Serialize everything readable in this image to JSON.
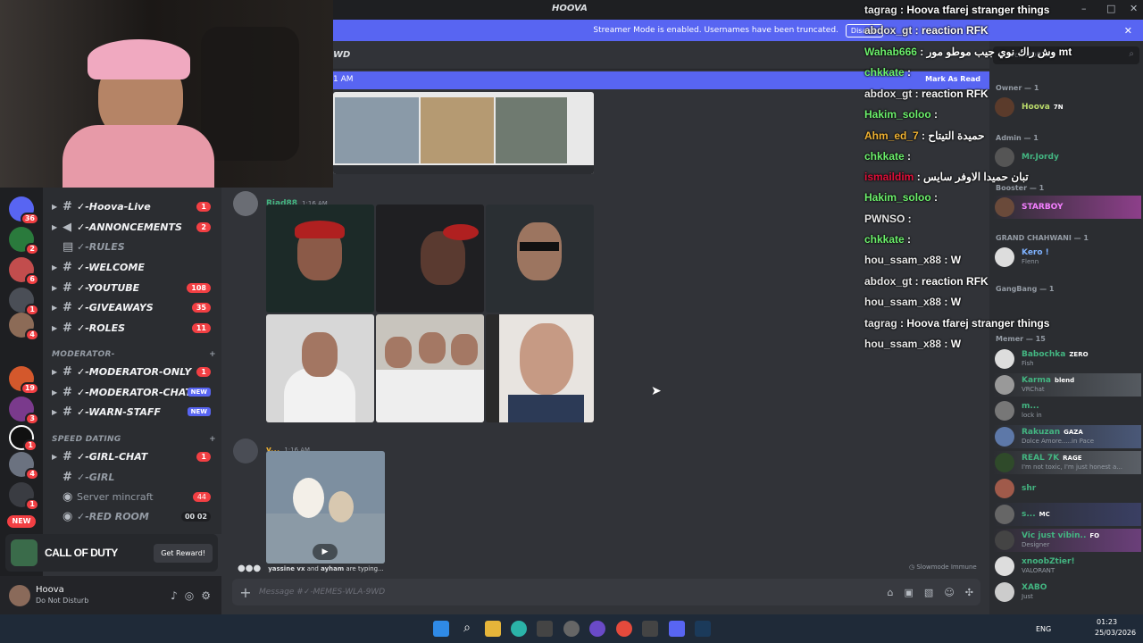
{
  "window": {
    "title": "HOOVA"
  },
  "banner": {
    "text": "Streamer Mode is enabled. Usernames have been truncated.",
    "disable": "Disable"
  },
  "channel_header": {
    "name_fragment": "WD"
  },
  "new_messages": {
    "time_fragment": "1 AM",
    "mark_read": "Mark As Read"
  },
  "server_badges": [
    "36",
    "2",
    "6",
    "1",
    "4",
    "19",
    "3",
    "1",
    "4",
    "1"
  ],
  "server_new": "NEW",
  "channels": [
    {
      "name": "✓-Hoova-Live",
      "badge": "1",
      "type": "text"
    },
    {
      "name": "✓-ANNONCEMENTS",
      "badge": "2",
      "type": "announce"
    },
    {
      "name": "✓-RULES",
      "badge": "",
      "type": "rules"
    },
    {
      "name": "✓-WELCOME",
      "badge": "",
      "type": "text"
    },
    {
      "name": "✓-YOUTUBE",
      "badge": "108",
      "type": "text"
    },
    {
      "name": "✓-GIVEAWAYS",
      "badge": "35",
      "type": "text"
    },
    {
      "name": "✓-ROLES",
      "badge": "11",
      "type": "text"
    }
  ],
  "category_moderator": "MODERATOR-",
  "moderator_channels": [
    {
      "name": "✓-MODERATOR-ONLY",
      "badge": "1",
      "new": false
    },
    {
      "name": "✓-MODERATOR-CHAT",
      "badge": "",
      "new": true
    },
    {
      "name": "✓-WARN-STAFF",
      "badge": "",
      "new": true
    }
  ],
  "category_speed": "SPEED DATING",
  "speed_channels": [
    {
      "name": "✓-GIRL-CHAT",
      "badge": "1"
    },
    {
      "name": "✓-GIRL",
      "badge": ""
    },
    {
      "name": "Server mincraft",
      "badge": "44"
    },
    {
      "name": "✓-RED ROOM",
      "badge": "00 02"
    }
  ],
  "new_label": "NEW",
  "promo": {
    "name": "CALL OF DUTY",
    "button": "Get Reward!"
  },
  "user": {
    "name": "Hoova",
    "status": "Do Not Disturb"
  },
  "messages": [
    {
      "author": "Riad88",
      "time": "1:16 AM",
      "color": "#43b581"
    },
    {
      "author": "y...",
      "time": "1:16 AM",
      "color": "#f0b232"
    }
  ],
  "typing": {
    "text_a": "yassine vx",
    "joiner": "and",
    "text_b": "ayham",
    "suffix": "are typing..."
  },
  "slowmode": "Slowmode Immune",
  "composer": {
    "placeholder": "Message #✓-MEMES-WLA-9WD"
  },
  "search": {
    "placeholder": "Search HOOVA"
  },
  "member_groups": [
    {
      "label": "Owner — 1",
      "members": [
        {
          "name": "Hoova",
          "tag": "7N",
          "sub": "",
          "color": "#b9d96a"
        }
      ]
    },
    {
      "label": "Admin — 1",
      "members": [
        {
          "name": "Mr.Jordy",
          "tag": "",
          "sub": "",
          "color": "#43b581"
        }
      ]
    },
    {
      "label": "Booster — 1",
      "members": [
        {
          "name": "STARBOY",
          "tag": "",
          "sub": "",
          "color": "#f47fff"
        }
      ]
    },
    {
      "label": "GRAND CHAHWANI — 1",
      "members": [
        {
          "name": "Kero !",
          "tag": "",
          "sub": "Flenn",
          "color": "#7fb2ff"
        }
      ]
    },
    {
      "label": "GangBang — 1",
      "members": []
    },
    {
      "label": "Memer — 15",
      "members": [
        {
          "name": "Babochka",
          "tag": "ZERO",
          "sub": "Fish",
          "color": "#43b581"
        },
        {
          "name": "Karma",
          "tag": "blend",
          "sub": "VRChat",
          "color": "#43b581"
        },
        {
          "name": "m...",
          "tag": "",
          "sub": "lock in",
          "color": "#43b581"
        },
        {
          "name": "Rakuzan",
          "tag": "GAZA",
          "sub": "Dolce Amore.....in Pace",
          "color": "#43b581"
        },
        {
          "name": "REAL 7K",
          "tag": "RAGE",
          "sub": "I'm not toxic, I'm just honest a...",
          "color": "#43b581"
        },
        {
          "name": "shr",
          "tag": "",
          "sub": "",
          "color": "#43b581"
        },
        {
          "name": "s...",
          "tag": "MC",
          "sub": "",
          "color": "#43b581"
        },
        {
          "name": "Vic just vibin..",
          "tag": "FO",
          "sub": "Designer",
          "color": "#43b581"
        },
        {
          "name": "xnoobZtier!",
          "tag": "",
          "sub": "VALORANT",
          "color": "#43b581"
        },
        {
          "name": "XABO",
          "tag": "",
          "sub": "Just",
          "color": "#43b581"
        }
      ]
    }
  ],
  "chat_overlay": [
    {
      "user": "tagrag",
      "msg": "Hoova tfarej stranger things",
      "color": "#e7e7e7"
    },
    {
      "user": "abdox_gt",
      "msg": "reaction RFK",
      "color": "#e7e7e7"
    },
    {
      "user": "Wahab666",
      "msg": "وش راك نوي جيب موطو مور mt",
      "color": "#6cf06c"
    },
    {
      "user": "chkkate",
      "msg": "",
      "color": "#6cf06c"
    },
    {
      "user": "abdox_gt",
      "msg": "reaction RFK",
      "color": "#e7e7e7"
    },
    {
      "user": "Hakim_soloo",
      "msg": "",
      "color": "#6cf06c"
    },
    {
      "user": "Ahm_ed_7",
      "msg": "حميدة التيتاح",
      "color": "#f0b232"
    },
    {
      "user": "chkkate",
      "msg": "",
      "color": "#6cf06c"
    },
    {
      "user": "ismaildim",
      "msg": "تبان حميدا الاوفر سايس",
      "color": "#e0103a"
    },
    {
      "user": "Hakim_soloo",
      "msg": "",
      "color": "#6cf06c"
    },
    {
      "user": "PWNSO",
      "msg": "",
      "color": "#e7e7e7"
    },
    {
      "user": "chkkate",
      "msg": "",
      "color": "#6cf06c"
    },
    {
      "user": "hou_ssam_x88",
      "msg": "W",
      "color": "#e7e7e7"
    },
    {
      "user": "abdox_gt",
      "msg": "reaction RFK",
      "color": "#e7e7e7"
    },
    {
      "user": "hou_ssam_x88",
      "msg": "W",
      "color": "#e7e7e7"
    },
    {
      "user": "tagrag",
      "msg": "Hoova tfarej stranger things",
      "color": "#e7e7e7"
    },
    {
      "user": "hou_ssam_x88",
      "msg": "W",
      "color": "#e7e7e7"
    }
  ],
  "taskbar": {
    "lang": "ENG",
    "time": "01:23",
    "date": "25/03/2026"
  },
  "colors": {
    "accent": "#5865f2",
    "danger": "#f23f43",
    "bg": "#313338",
    "sidebar": "#2b2d31"
  }
}
